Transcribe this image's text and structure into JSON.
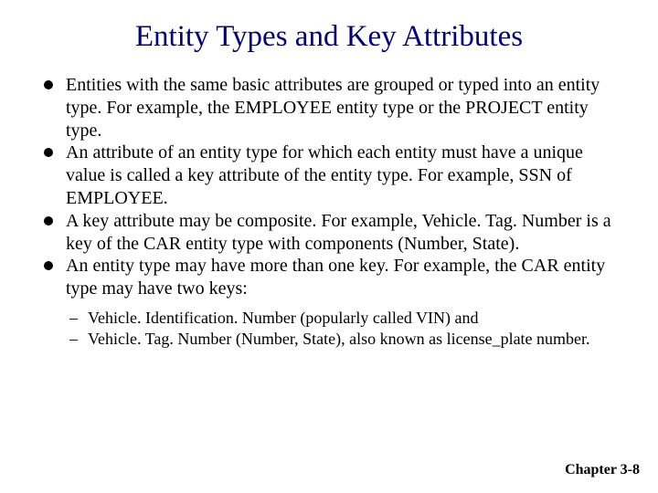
{
  "title": "Entity Types and Key Attributes",
  "bullets": [
    "Entities with the same basic attributes are grouped or typed into an entity type. For example, the EMPLOYEE entity type or the PROJECT entity type.",
    "An attribute of an entity type for which each entity must have a unique value is called a key attribute of the entity type. For example, SSN of EMPLOYEE.",
    "A key attribute may be composite. For example, Vehicle. Tag. Number is a key of the CAR entity type with components (Number, State).",
    "An entity type may have more than one key. For example, the CAR entity type may have two keys:"
  ],
  "subbullets": [
    "Vehicle. Identification. Number (popularly called VIN) and",
    "Vehicle. Tag. Number (Number, State), also known as license_plate number."
  ],
  "footer": "Chapter 3-8"
}
